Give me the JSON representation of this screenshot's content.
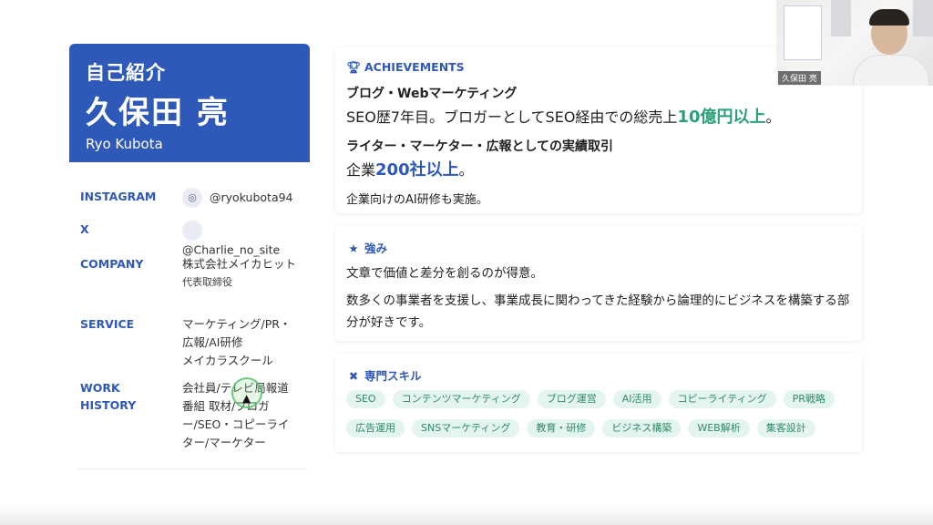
{
  "profile": {
    "label": "自己紹介",
    "name": "久保田 亮",
    "name_roman": "Ryo Kubota"
  },
  "info": {
    "instagram_key": "INSTAGRAM",
    "instagram_val": "@ryokubota94",
    "x_key": "X",
    "x_val": "@Charlie_no_site",
    "company_key": "COMPANY",
    "company_val": "株式会社メイカヒット",
    "company_role": "代表取締役",
    "service_key": "SERVICE",
    "service_l1": "マーケティング/PR・",
    "service_l2": "広報/AI研修",
    "service_l3": "メイカラスクール",
    "work_key_1": "WORK",
    "work_key_2": "HISTORY",
    "work_l1": "会社員/テレビ局報道",
    "work_l2": "番組 取材/ブロガ",
    "work_l3": "ー/SEO・コピーライ",
    "work_l4": "ター/マーケター"
  },
  "achievements": {
    "title": "ACHIEVEMENTS",
    "h1": "ブログ・Webマーケティング",
    "t1_pre": "SEO歴7年目。ブロガーとしてSEO経由での総売上",
    "t1_hl": "10億円以上",
    "t1_post": "。",
    "h2": "ライター・マーケター・広報としての実績取引",
    "t2_pre": "企業",
    "t2_hl": "200社以上",
    "t2_post": "。",
    "t3": "企業向けのAI研修も実施。"
  },
  "strengths": {
    "title": "強み",
    "s1": "文章で価値と差分を創るのが得意。",
    "s2": "数多くの事業者を支援し、事業成長に関わってきた経験から論理的にビジネスを構築する部分が好きです。"
  },
  "skills": {
    "title": "専門スキル",
    "chips": [
      "SEO",
      "コンテンツマーケティング",
      "ブログ運営",
      "AI活用",
      "コピーライティング",
      "PR戦略",
      "広告運用",
      "SNSマーケティング",
      "教育・研修",
      "ビジネス構築",
      "WEB解析",
      "集客設計"
    ]
  },
  "video": {
    "participant_name": "久保田 亮"
  },
  "colors": {
    "accent_blue": "#2f59b8",
    "accent_green": "#2aa07a",
    "chip_bg": "#e4f5ef"
  }
}
